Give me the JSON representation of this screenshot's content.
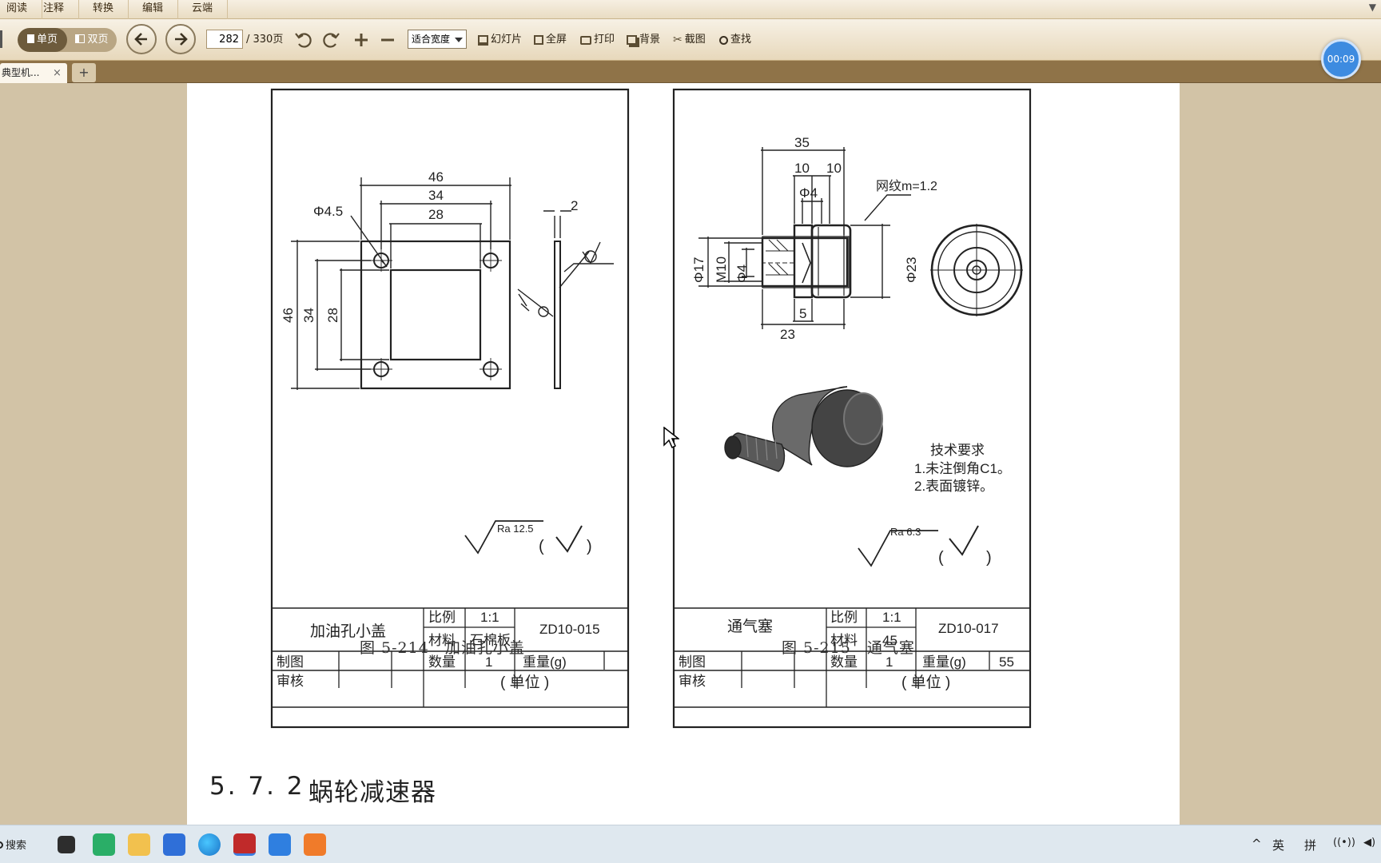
{
  "menu": {
    "tabs": [
      "阅读",
      "注释",
      "转换",
      "编辑",
      "云端"
    ]
  },
  "toolbar": {
    "single_page": "单页",
    "double_page": "双页",
    "page_current": "282",
    "page_total": "/ 330页",
    "zoom": "适合宽度",
    "slideshow": "幻灯片",
    "fullscreen": "全屏",
    "print": "打印",
    "background": "背景",
    "screenshot": "截图",
    "find": "查找"
  },
  "tabs": {
    "doc_tab": "典型机...",
    "close": "×",
    "new": "+"
  },
  "timer": "00:09",
  "document": {
    "fig214": {
      "dims": {
        "d46_top": "46",
        "d34_top": "34",
        "d28_top": "28",
        "hole": "Φ4.5",
        "thk": "2",
        "d46_left": "46",
        "d34_left": "34",
        "d28_left": "28",
        "ra": "Ra 12.5"
      },
      "title_block": {
        "name": "加油孔小盖",
        "scale_label": "比例",
        "scale": "1:1",
        "material_label": "材料",
        "material": "石棉板",
        "code": "ZD10-015",
        "drawn": "制图",
        "qty_label": "数量",
        "qty": "1",
        "weight_label": "重量(g)",
        "weight": "",
        "checked": "审核",
        "unit": "( 单位 )"
      },
      "caption": "图 5-214　加油孔小盖"
    },
    "fig215": {
      "dims": {
        "d35": "35",
        "d10a": "10",
        "d10b": "10",
        "knurl": "网纹m=1.2",
        "phi4_top": "Φ4",
        "phi17": "Φ17",
        "m10": "M10",
        "phi4_side": "Φ4",
        "phi23": "Φ23",
        "d5": "5",
        "d23": "23",
        "ra": "Ra 6.3"
      },
      "tech_req": [
        "技术要求",
        "1.未注倒角C1。",
        "2.表面镀锌。"
      ],
      "title_block": {
        "name": "通气塞",
        "scale_label": "比例",
        "scale": "1:1",
        "material_label": "材料",
        "material": "45",
        "code": "ZD10-017",
        "drawn": "制图",
        "qty_label": "数量",
        "qty": "1",
        "weight_label": "重量(g)",
        "weight": "55",
        "checked": "审核",
        "unit": "( 单位 )"
      },
      "caption": "图 5-215　通气塞"
    },
    "section": {
      "number": "5. 7. 2",
      "title": "蜗轮减速器"
    }
  },
  "taskbar": {
    "search": "搜索",
    "ime_lang": "英",
    "ime_mode": "拼"
  }
}
